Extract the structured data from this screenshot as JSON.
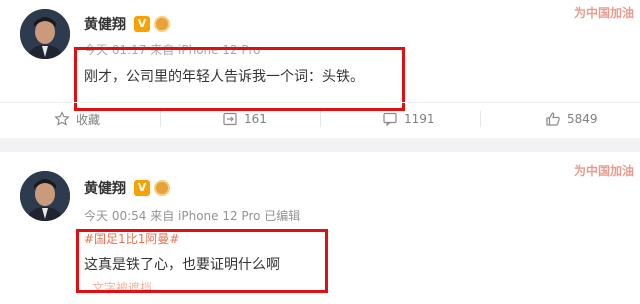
{
  "posts": [
    {
      "username": "黄健翔",
      "verified_badge": "V",
      "meta": "今天 01:17 来自 iPhone 12 Pro",
      "text": "刚才，公司里的年轻人告诉我一个词：头铁。",
      "banner": "为中国加油",
      "actions": {
        "favorite": "收藏",
        "repost": "161",
        "comment": "1191",
        "like": "5849"
      }
    },
    {
      "username": "黄健翔",
      "verified_badge": "V",
      "meta": "今天 00:54 来自 iPhone 12 Pro  已编辑",
      "hashtag": "#国足1比1阿曼#",
      "text": "这真是铁了心，也要证明什么啊",
      "link": "文字被遮挡",
      "banner": "为中国加油"
    }
  ],
  "icons": {
    "favorite": "star-icon",
    "repost": "repost-icon",
    "comment": "comment-icon",
    "like": "thumbs-up-icon",
    "medal": "medal-icon"
  },
  "colors": {
    "highlight_box": "#e01010",
    "badge": "#f7a200",
    "hashtag": "#eb7350"
  }
}
